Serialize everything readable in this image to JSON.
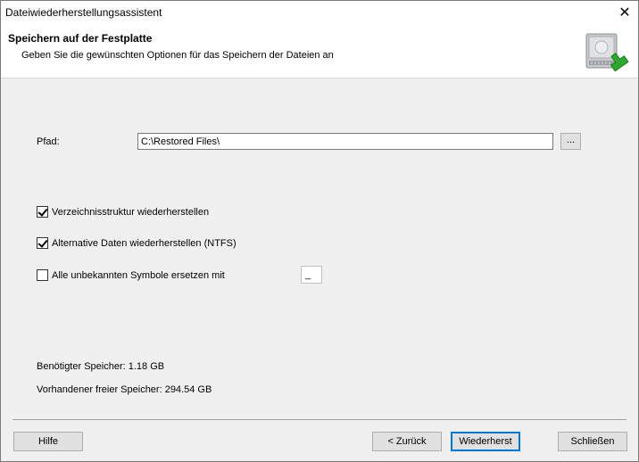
{
  "window": {
    "title": "Dateiwiederherstellungsassistent",
    "close_glyph": "✕"
  },
  "header": {
    "title": "Speichern auf der Festplatte",
    "subtitle": "Geben Sie die gewünschten Optionen für das Speichern der Dateien an",
    "icon": "hard-drive-restore-icon"
  },
  "path": {
    "label": "Pfad:",
    "value": "C:\\Restored Files\\",
    "browse_label": "..."
  },
  "options": [
    {
      "label": "Verzeichnisstruktur wiederherstellen",
      "checked": true
    },
    {
      "label": "Alternative Daten wiederherstellen (NTFS)",
      "checked": true
    },
    {
      "label": "Alle unbekannten Symbole ersetzen mit",
      "checked": false
    }
  ],
  "replace_symbol": "_",
  "storage": {
    "required": "Benötigter Speicher: 1.18 GB",
    "free": "Vorhandener freier Speicher: 294.54 GB"
  },
  "buttons": {
    "help": "Hilfe",
    "back": "< Zurück",
    "restore": "Wiederherst",
    "close": "Schließen"
  },
  "colors": {
    "accent": "#0078d7",
    "arrow_green": "#2ea82e"
  }
}
